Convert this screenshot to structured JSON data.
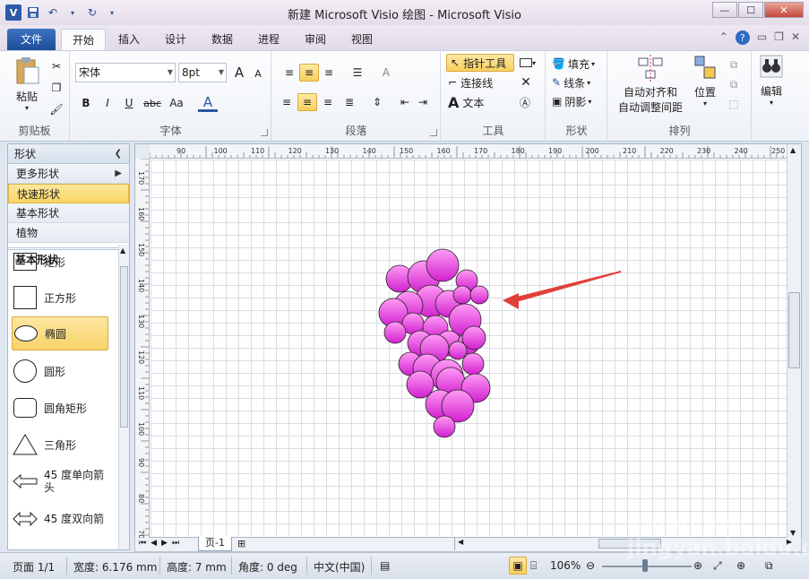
{
  "title_bar": {
    "title": "新建 Microsoft Visio 绘图 - Microsoft Visio"
  },
  "tabs": {
    "file": "文件",
    "home": "开始",
    "insert": "插入",
    "design": "设计",
    "data": "数据",
    "process": "进程",
    "review": "审阅",
    "view": "视图"
  },
  "ribbon": {
    "clipboard": {
      "paste": "粘贴",
      "label": "剪贴板"
    },
    "font": {
      "name": "宋体",
      "size": "8pt",
      "label": "字体",
      "bold": "B",
      "italic": "I",
      "underline": "U",
      "strike": "abc",
      "case": "Aa",
      "color": "A",
      "grow": "A",
      "shrink": "A"
    },
    "paragraph": {
      "label": "段落"
    },
    "tools": {
      "pointer": "指针工具",
      "connector": "连接线",
      "text": "文本",
      "label": "工具"
    },
    "shape": {
      "fill": "填充",
      "line": "线条",
      "shadow": "阴影",
      "label": "形状"
    },
    "arrange": {
      "auto_align": "自动对齐和",
      "auto_space": "自动调整间距",
      "position": "位置",
      "label": "排列"
    },
    "edit": {
      "label": "编辑"
    }
  },
  "shapes_panel": {
    "header": "形状",
    "rows": [
      "更多形状",
      "快速形状",
      "基本形状",
      "植物"
    ],
    "stencil_title": "基本形状",
    "items": [
      "矩形",
      "正方形",
      "椭圆",
      "圆形",
      "圆角矩形",
      "三角形",
      "45 度单向箭头",
      "45 度双向箭"
    ]
  },
  "ruler": {
    "h_ticks": [
      "90",
      "100",
      "110",
      "120",
      "130",
      "140",
      "150",
      "160",
      "170",
      "180",
      "190",
      "200",
      "210",
      "220",
      "230",
      "240",
      "250"
    ],
    "v_ticks": [
      "170",
      "160",
      "150",
      "140",
      "130",
      "120",
      "110",
      "100",
      "90",
      "80",
      "70"
    ]
  },
  "page_tab": {
    "name": "页-1"
  },
  "status": {
    "page": "页面 1/1",
    "width": "宽度: 6.176 mm",
    "height": "高度: 7 mm",
    "angle": "角度: 0 deg",
    "lang": "中文(中国)",
    "zoom": "106%"
  },
  "watermark": "Baidu 经验 jingyan.baidu.com",
  "colors": {
    "grape_top": "#ff9cf5",
    "grape_bottom": "#d11fcf",
    "arrow": "#e0403a",
    "accent": "#f8cf5c"
  }
}
